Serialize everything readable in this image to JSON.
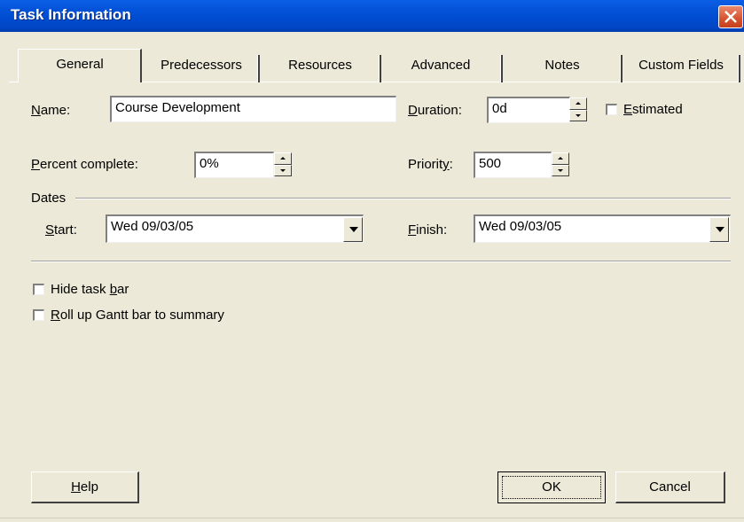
{
  "window": {
    "title": "Task Information"
  },
  "tabs": [
    {
      "label": "General"
    },
    {
      "label": "Predecessors"
    },
    {
      "label": "Resources"
    },
    {
      "label": "Advanced"
    },
    {
      "label": "Notes"
    },
    {
      "label": "Custom Fields"
    }
  ],
  "general": {
    "name": {
      "label_mnemonic": "N",
      "label_rest": "ame:",
      "value": "Course Development"
    },
    "duration": {
      "label_mnemonic": "D",
      "label_rest": "uration:",
      "value": "0d"
    },
    "estimated": {
      "label_mnemonic": "E",
      "label_rest": "stimated",
      "checked": false
    },
    "percent_complete": {
      "label_mnemonic": "P",
      "label_rest": "ercent complete:",
      "value": "0%"
    },
    "priority": {
      "label_prefix": "Priorit",
      "label_mnemonic": "y",
      "label_suffix": ":",
      "value": "500"
    },
    "dates_group": {
      "label": "Dates"
    },
    "start": {
      "label_mnemonic": "S",
      "label_rest": "tart:",
      "value": "Wed 09/03/05"
    },
    "finish": {
      "label_mnemonic": "F",
      "label_rest": "inish:",
      "value": "Wed 09/03/05"
    },
    "hide_task_bar": {
      "label_prefix": "Hide task ",
      "label_mnemonic": "b",
      "label_suffix": "ar",
      "checked": false
    },
    "roll_up": {
      "label_mnemonic": "R",
      "label_rest": "oll up Gantt bar to summary",
      "checked": false
    }
  },
  "buttons": {
    "help": {
      "label_mnemonic": "H",
      "label_rest": "elp"
    },
    "ok": {
      "label": "OK"
    },
    "cancel": {
      "label": "Cancel"
    }
  }
}
